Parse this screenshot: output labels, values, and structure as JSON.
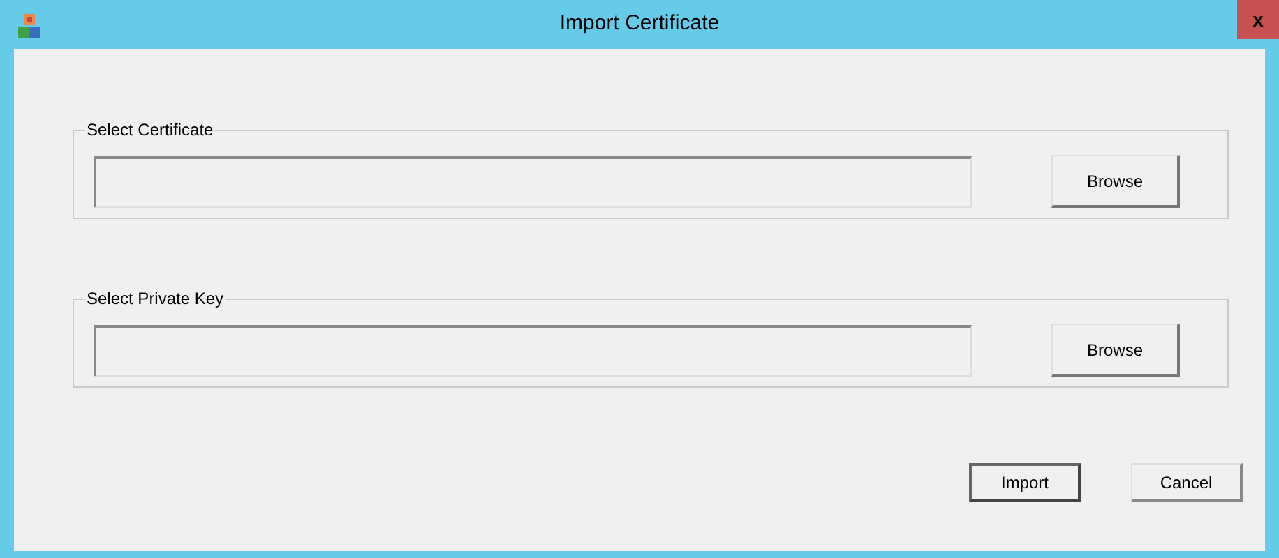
{
  "window": {
    "title": "Import Certificate",
    "close": "x"
  },
  "groups": [
    {
      "label": "Select Certificate",
      "button": "Browse"
    },
    {
      "label": "Select Private Key",
      "button": "Browse"
    }
  ],
  "buttons": [
    {
      "label": "Import",
      "default": true
    },
    {
      "label": "Cancel",
      "default": false
    }
  ]
}
